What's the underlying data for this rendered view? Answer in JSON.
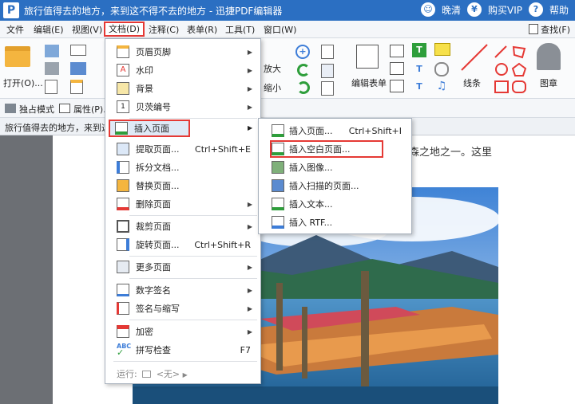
{
  "title_bar": {
    "app_logo": "P",
    "title": "旅行值得去的地方，来到这不得不去的地方 - 迅捷PDF编辑器",
    "user_name": "晚清",
    "buy_vip": "购买VIP",
    "help": "帮助"
  },
  "menu": {
    "items": [
      "文件",
      "编辑(E)",
      "视图(V)",
      "文档(D)",
      "注释(C)",
      "表单(R)",
      "工具(T)",
      "窗口(W)"
    ],
    "search_label": "查找(F)"
  },
  "ribbon": {
    "open_label": "打开(O)...",
    "zoom_in_label": "放大",
    "zoom_out_label": "缩小",
    "edit_form_label": "编辑表单",
    "line_label": "线条",
    "stamp_label": "图章"
  },
  "ribbon2": {
    "exclusive_mode": "独占模式",
    "properties": "属性(P)..."
  },
  "tab": {
    "doc_title": "旅行值得去的地方，来到这不"
  },
  "page": {
    "visible_text": "森之地之一。这里"
  },
  "document_menu": {
    "items": [
      {
        "label": "页眉页脚",
        "shortcut": "",
        "has_submenu": true
      },
      {
        "label": "水印",
        "shortcut": "",
        "has_submenu": true
      },
      {
        "label": "背景",
        "shortcut": "",
        "has_submenu": true
      },
      {
        "label": "贝茨编号",
        "shortcut": "",
        "has_submenu": true
      },
      {
        "label": "插入页面",
        "shortcut": "",
        "has_submenu": true
      },
      {
        "label": "提取页面...",
        "shortcut": "Ctrl+Shift+E",
        "has_submenu": false
      },
      {
        "label": "拆分文档...",
        "shortcut": "",
        "has_submenu": false
      },
      {
        "label": "替换页面...",
        "shortcut": "",
        "has_submenu": false
      },
      {
        "label": "删除页面",
        "shortcut": "",
        "has_submenu": true
      },
      {
        "label": "裁剪页面",
        "shortcut": "",
        "has_submenu": true
      },
      {
        "label": "旋转页面...",
        "shortcut": "Ctrl+Shift+R",
        "has_submenu": false
      },
      {
        "label": "更多页面",
        "shortcut": "",
        "has_submenu": true
      },
      {
        "label": "数字签名",
        "shortcut": "",
        "has_submenu": true
      },
      {
        "label": "签名与缩写",
        "shortcut": "",
        "has_submenu": true
      },
      {
        "label": "加密",
        "shortcut": "",
        "has_submenu": true
      },
      {
        "label": "拼写检查",
        "shortcut": "F7",
        "has_submenu": false
      }
    ],
    "footer_run": "运行:",
    "footer_none": "<无>"
  },
  "insert_page_submenu": {
    "items": [
      {
        "label": "插入页面...",
        "shortcut": "Ctrl+Shift+I"
      },
      {
        "label": "插入空白页面...",
        "shortcut": ""
      },
      {
        "label": "插入图像...",
        "shortcut": ""
      },
      {
        "label": "插入扫描的页面...",
        "shortcut": ""
      },
      {
        "label": "插入文本...",
        "shortcut": ""
      },
      {
        "label": "插入 RTF...",
        "shortcut": ""
      }
    ]
  },
  "colors": {
    "title_bar": "#2b6fc2",
    "highlight_border": "#e53935",
    "menu_bg": "#ffffff"
  }
}
